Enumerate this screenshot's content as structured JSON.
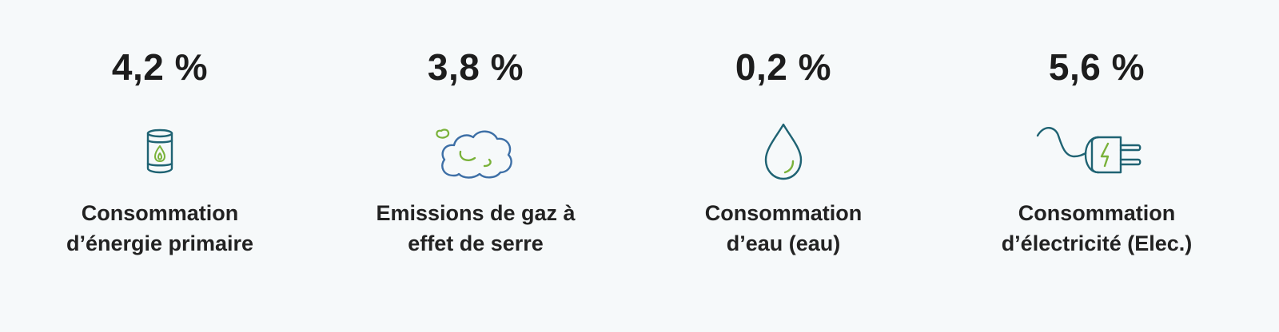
{
  "stats": [
    {
      "value": "4,2 %",
      "icon": "fuel-barrel-icon",
      "label_line1": "Consommation",
      "label_line2": "d’énergie primaire"
    },
    {
      "value": "3,8 %",
      "icon": "gas-cloud-icon",
      "label_line1": "Emissions de gaz à",
      "label_line2": "effet de serre"
    },
    {
      "value": "0,2 %",
      "icon": "water-drop-icon",
      "label_line1": "Consommation",
      "label_line2": "d’eau (eau)"
    },
    {
      "value": "5,6 %",
      "icon": "electric-plug-icon",
      "label_line1": "Consommation",
      "label_line2": "d’électricité (Elec.)"
    }
  ],
  "colors": {
    "background": "#f6f9fa",
    "icon_outline": "#1f6373",
    "icon_outline_blue": "#3d6fa6",
    "icon_accent": "#7ab23a",
    "text": "#1d1d1d"
  }
}
